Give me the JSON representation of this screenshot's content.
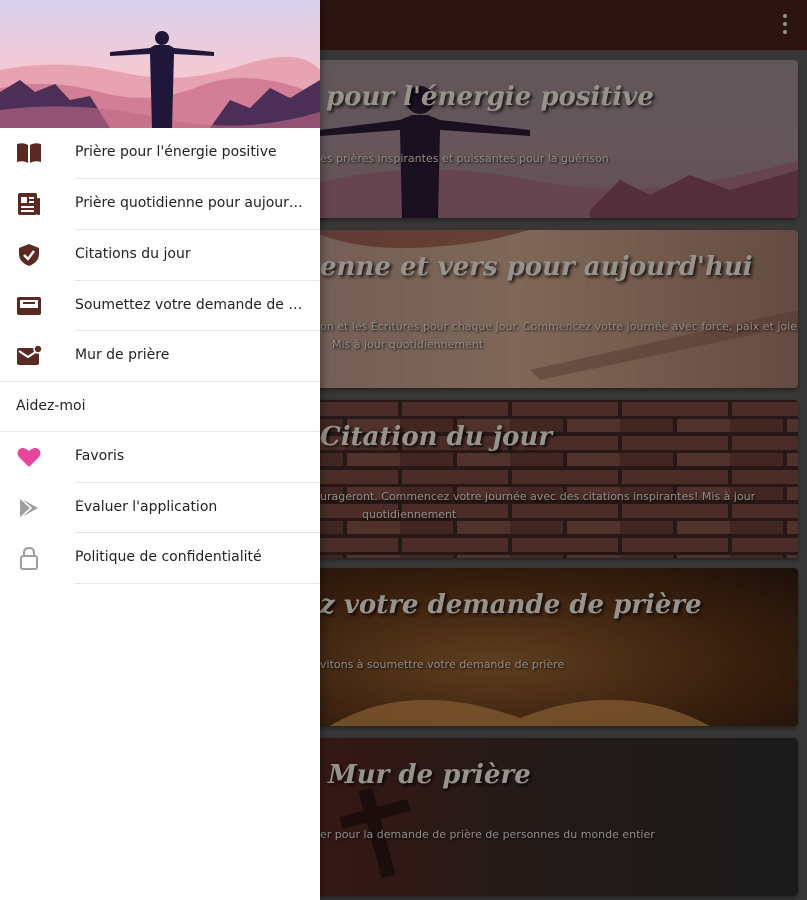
{
  "background": {
    "cards": [
      {
        "title": "pour l'énergie positive",
        "desc": "es prières inspirantes et puissantes pour la guérison"
      },
      {
        "title": "enne et vers pour aujourd'hui",
        "desc": "on et les Écritures pour chaque jour. Commencez votre journée avec force, paix et joie!",
        "desc2": "Mis à jour quotidiennement"
      },
      {
        "title": "Citation du jour",
        "desc": "urageront. Commencez votre journée avec des citations inspirantes! Mis à jour",
        "desc2": "quotidiennement"
      },
      {
        "title": "z votre demande de prière",
        "desc": "vitons à soumettre votre demande de prière"
      },
      {
        "title": "Mur de prière",
        "desc": "er pour la demande de prière de personnes du monde entier"
      }
    ]
  },
  "drawer": {
    "items": [
      {
        "label": "Prière pour l'énergie positive",
        "icon": "book-icon"
      },
      {
        "label": "Prière quotidienne pour aujourd'hui",
        "icon": "newspaper-icon"
      },
      {
        "label": "Citations du jour",
        "icon": "shield-check-icon"
      },
      {
        "label": "Soumettez votre demande de prière",
        "icon": "inbox-icon"
      },
      {
        "label": "Mur de prière",
        "icon": "mail-icon"
      }
    ],
    "section_label": "Aidez-moi",
    "help_items": [
      {
        "label": "Favoris",
        "icon": "heart-icon"
      },
      {
        "label": "Évaluer l'application",
        "icon": "play-store-icon"
      },
      {
        "label": "Politique de confidentialité",
        "icon": "lock-icon"
      }
    ]
  },
  "colors": {
    "appbar": "#47221c",
    "icon": "#5a2a22",
    "heart": "#e8469a",
    "grey_icon": "#9e9e9e"
  }
}
